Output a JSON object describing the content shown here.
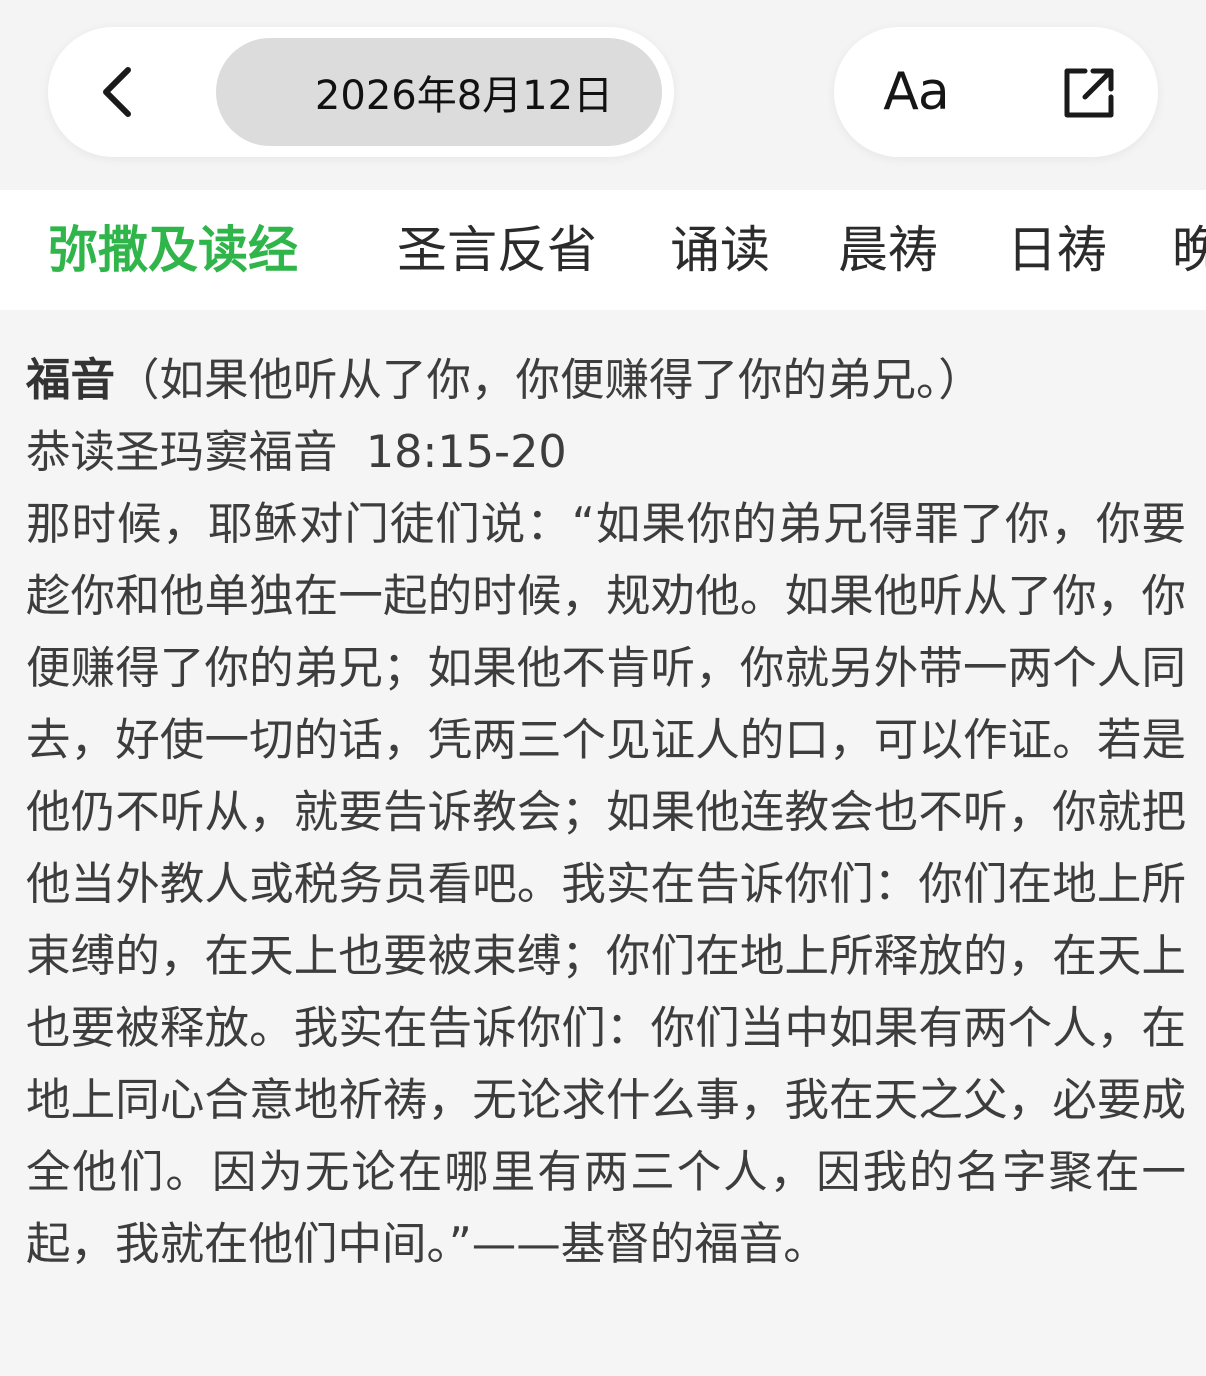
{
  "header": {
    "date": "2026年8月12日",
    "font_button_label": "Aa",
    "back_icon": "chevron-left-icon",
    "share_icon": "share-external-icon"
  },
  "tabs": [
    {
      "label": "弥撒及读经",
      "active": true
    },
    {
      "label": "圣言反省",
      "active": false
    },
    {
      "label": "诵读",
      "active": false
    },
    {
      "label": "晨祷",
      "active": false
    },
    {
      "label": "日祷",
      "active": false
    },
    {
      "label": "晚",
      "active": false
    }
  ],
  "reading": {
    "section_label": "福音",
    "section_subtitle": "（如果他听从了你，你便赚得了你的弟兄。）",
    "source": "恭读圣玛窦福音",
    "reference": "18:15-20",
    "body": "那时候，耶稣对门徒们说：“如果你的弟兄得罪了你，你要趁你和他单独在一起的时候，规劝他。如果他听从了你，你便赚得了你的弟兄；如果他不肯听，你就另外带一两个人同去，好使一切的话，凭两三个见证人的口，可以作证。若是他仍不听从，就要告诉教会；如果他连教会也不听，你就把他当外教人或税务员看吧。我实在告诉你们：你们在地上所束缚的，在天上也要被束缚；你们在地上所释放的，在天上也要被释放。我实在告诉你们：你们当中如果有两个人，在地上同心合意地祈祷，无论求什么事，我在天之父，必要成全他们。因为无论在哪里有两三个人，因我的名字聚在一起，我就在他们中间。”——基督的福音。"
  },
  "colors": {
    "accent": "#2fb54a",
    "background": "#f5f5f5",
    "text": "#3d3d3d"
  }
}
